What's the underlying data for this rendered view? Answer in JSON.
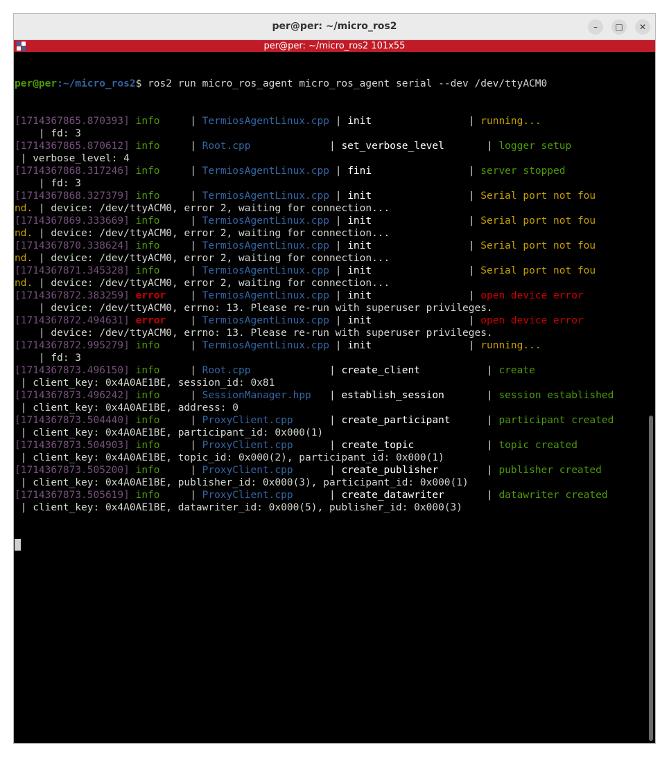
{
  "window": {
    "title": "per@per: ~/micro_ros2",
    "controls": {
      "minimize": "–",
      "maximize": "□",
      "close": "✕"
    }
  },
  "tab_bar": {
    "title": "per@per: ~/micro_ros2 101x55"
  },
  "prompt": {
    "user": "per@per",
    "path": ":~/micro_ros2",
    "symbol": "$ ",
    "command": "ros2 run micro_ros_agent micro_ros_agent serial --dev /dev/ttyACM0"
  },
  "log": [
    {
      "ts": "[1714367865.870393] ",
      "level": "info",
      "lvl": "info     ",
      "file": "TermiosAgentLinux.cpp",
      "fn": "init                ",
      "msg": "running...",
      "msgclass": "c-warn",
      "cont": "    | fd: 3"
    },
    {
      "ts": "[1714367865.870612] ",
      "level": "info",
      "lvl": "info     ",
      "file": "Root.cpp",
      "fn": "set_verbose_level       ",
      "msg": "logger setup",
      "msgclass": "c-ok",
      "cont": " | verbose_level: 4"
    },
    {
      "ts": "[1714367868.317246] ",
      "level": "info",
      "lvl": "info     ",
      "file": "TermiosAgentLinux.cpp",
      "fn": "fini                ",
      "msg": "server stopped",
      "msgclass": "c-ok",
      "cont": "    | fd: 3"
    },
    {
      "ts": "[1714367868.327379] ",
      "level": "info",
      "lvl": "info     ",
      "file": "TermiosAgentLinux.cpp",
      "fn": "init                ",
      "msg": "Serial port not fou",
      "msgclass": "c-warn",
      "cont_warn": "nd.",
      "cont": " | device: /dev/ttyACM0, error 2, waiting for connection..."
    },
    {
      "ts": "[1714367869.333669] ",
      "level": "info",
      "lvl": "info     ",
      "file": "TermiosAgentLinux.cpp",
      "fn": "init                ",
      "msg": "Serial port not fou",
      "msgclass": "c-warn",
      "cont_warn": "nd.",
      "cont": " | device: /dev/ttyACM0, error 2, waiting for connection..."
    },
    {
      "ts": "[1714367870.338624] ",
      "level": "info",
      "lvl": "info     ",
      "file": "TermiosAgentLinux.cpp",
      "fn": "init                ",
      "msg": "Serial port not fou",
      "msgclass": "c-warn",
      "cont_warn": "nd.",
      "cont": " | device: /dev/ttyACM0, error 2, waiting for connection..."
    },
    {
      "ts": "[1714367871.345328] ",
      "level": "info",
      "lvl": "info     ",
      "file": "TermiosAgentLinux.cpp",
      "fn": "init                ",
      "msg": "Serial port not fou",
      "msgclass": "c-warn",
      "cont_warn": "nd.",
      "cont": " | device: /dev/ttyACM0, error 2, waiting for connection..."
    },
    {
      "ts": "[1714367872.383259] ",
      "level": "error",
      "lvl": "error    ",
      "file": "TermiosAgentLinux.cpp",
      "fn": "init                ",
      "msg": "open device error",
      "msgclass": "c-err",
      "cont": "    | device: /dev/ttyACM0, errno: 13. Please re-run with superuser privileges."
    },
    {
      "ts": "[1714367872.494631] ",
      "level": "error",
      "lvl": "error    ",
      "file": "TermiosAgentLinux.cpp",
      "fn": "init                ",
      "msg": "open device error",
      "msgclass": "c-err",
      "cont": "    | device: /dev/ttyACM0, errno: 13. Please re-run with superuser privileges."
    },
    {
      "ts": "[1714367872.995279] ",
      "level": "info",
      "lvl": "info     ",
      "file": "TermiosAgentLinux.cpp",
      "fn": "init                ",
      "msg": "running...",
      "msgclass": "c-warn",
      "cont": "    | fd: 3"
    },
    {
      "ts": "[1714367873.496150] ",
      "level": "info",
      "lvl": "info     ",
      "file": "Root.cpp",
      "fn": "create_client           ",
      "msg": "create",
      "msgclass": "c-ok",
      "cont": " | client_key: 0x4A0AE1BE, session_id: 0x81"
    },
    {
      "ts": "[1714367873.496242] ",
      "level": "info",
      "lvl": "info     ",
      "file": "SessionManager.hpp",
      "fn": "establish_session       ",
      "msg": "session established",
      "msgclass": "c-ok",
      "cont": " | client_key: 0x4A0AE1BE, address: 0"
    },
    {
      "ts": "[1714367873.504440] ",
      "level": "info",
      "lvl": "info     ",
      "file": "ProxyClient.cpp",
      "fn": "create_participant      ",
      "msg": "participant created",
      "msgclass": "c-ok",
      "cont": " | client_key: 0x4A0AE1BE, participant_id: 0x000(1)"
    },
    {
      "ts": "[1714367873.504903] ",
      "level": "info",
      "lvl": "info     ",
      "file": "ProxyClient.cpp",
      "fn": "create_topic            ",
      "msg": "topic created",
      "msgclass": "c-ok",
      "cont": " | client_key: 0x4A0AE1BE, topic_id: 0x000(2), participant_id: 0x000(1)"
    },
    {
      "ts": "[1714367873.505200] ",
      "level": "info",
      "lvl": "info     ",
      "file": "ProxyClient.cpp",
      "fn": "create_publisher        ",
      "msg": "publisher created",
      "msgclass": "c-ok",
      "cont": " | client_key: 0x4A0AE1BE, publisher_id: 0x000(3), participant_id: 0x000(1)"
    },
    {
      "ts": "[1714367873.505619] ",
      "level": "info",
      "lvl": "info     ",
      "file": "ProxyClient.cpp",
      "fn": "create_datawriter       ",
      "msg": "datawriter created",
      "msgclass": "c-ok",
      "cont": " | client_key: 0x4A0AE1BE, datawriter_id: 0x000(5), publisher_id: 0x000(3)"
    }
  ],
  "colors": {
    "timestamp": "#75507b",
    "info": "#4e9a06",
    "error": "#cc0000",
    "file": "#3465a4",
    "warn": "#c4a000"
  }
}
